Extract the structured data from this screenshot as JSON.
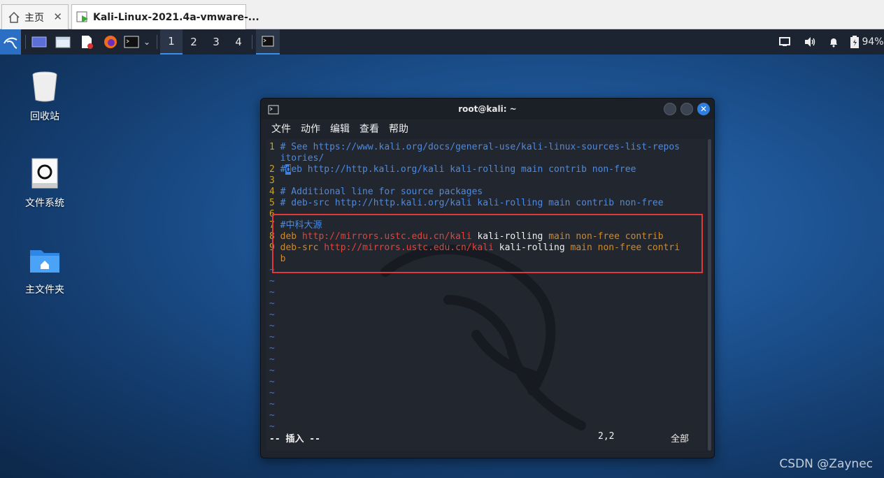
{
  "vmware": {
    "home_tab": "主页",
    "vm_tab": "Kali-Linux-2021.4a-vmware-..."
  },
  "panel": {
    "workspaces": [
      "1",
      "2",
      "3",
      "4"
    ],
    "battery": "94%"
  },
  "desktop": {
    "icons": [
      {
        "label": "回收站",
        "icon": "trash-icon"
      },
      {
        "label": "文件系统",
        "icon": "drive-icon"
      },
      {
        "label": "主文件夹",
        "icon": "home-folder-icon"
      }
    ],
    "watermark": "CSDN @Zaynec"
  },
  "terminal": {
    "title": "root@kali: ~",
    "menu": [
      "文件",
      "动作",
      "编辑",
      "查看",
      "帮助"
    ],
    "lines": {
      "l1a": "# See https://www.kali.org/docs/general-use/kali-linux-sources-list-repos",
      "l1b": "itories/",
      "l2_hash": "#",
      "l2_cursor": "d",
      "l2_rest": "eb http://http.kali.org/kali kali-rolling main contrib non-free",
      "l4": "# Additional line for source packages",
      "l5": "# deb-src http://http.kali.org/kali kali-rolling main contrib non-free",
      "l7": "#中科大源",
      "l8_kw": "deb",
      "l8_url": "http://mirrors.ustc.edu.cn/kali",
      "l8_dist": "kali-rolling",
      "l8_comp": "main non-free contrib",
      "l9_kw": "deb-src",
      "l9_url": "http://mirrors.ustc.edu.cn/kali",
      "l9_dist": "kali-rolling",
      "l9_comp": "main non-free contri",
      "l9_wrap": "b"
    },
    "line_numbers": [
      "1",
      "2",
      "3",
      "4",
      "5",
      "6",
      "7",
      "8",
      "9"
    ],
    "tilde": "~",
    "status_mode": "-- 插入 --",
    "status_pos": "2,2",
    "status_all": "全部"
  },
  "colors": {
    "accent": "#2f7fe0",
    "highlight_box": "#e0393a"
  }
}
